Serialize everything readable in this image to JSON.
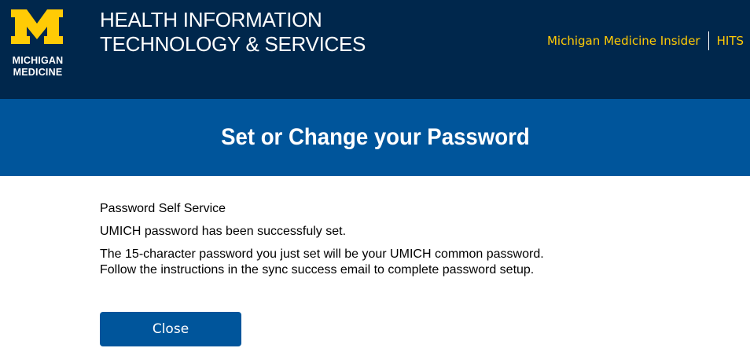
{
  "header": {
    "logo_line1": "MICHIGAN",
    "logo_line2": "MEDICINE",
    "title_line1": "HEALTH INFORMATION",
    "title_line2": "TECHNOLOGY & SERVICES",
    "links": [
      "Michigan Medicine Insider",
      "HITS"
    ],
    "brand_maize": "#ffcb05",
    "brand_blue": "#00274c"
  },
  "banner": {
    "title": "Set or Change your Password",
    "color": "#00559b"
  },
  "main": {
    "heading": "Password Self Service",
    "status": "UMICH password has been successfuly set.",
    "info_line1": "The 15-character password you just set will be your UMICH common password.",
    "info_line2": "Follow the instructions in the sync success email to complete password setup.",
    "close_label": "Close"
  }
}
